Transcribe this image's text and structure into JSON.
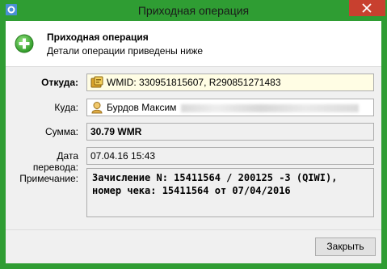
{
  "window": {
    "title": "Приходная операция"
  },
  "header": {
    "title": "Приходная операция",
    "subtitle": "Детали операции приведены ниже"
  },
  "fields": {
    "from": {
      "label": "Откуда:",
      "value": "WMID: 330951815607, R290851271483"
    },
    "to": {
      "label": "Куда:",
      "value": "Бурдов Максим"
    },
    "amount": {
      "label": "Сумма:",
      "value": "30.79 WMR"
    },
    "date": {
      "label": "Дата перевода:",
      "value": "07.04.16 15:43"
    },
    "note": {
      "label": "Примечание:",
      "value": "Зачисление N: 15411564 / 200125 -3 (QIWI), номер чека: 15411564 от  07/04/2016"
    }
  },
  "footer": {
    "close_label": "Закрыть"
  },
  "icons": {
    "title": "webmoney-icon",
    "header": "plus-icon",
    "from": "wallet-icon",
    "to": "user-icon"
  },
  "colors": {
    "titlebar": "#2f9d33",
    "close": "#c8402f",
    "from_field": "#fffde4"
  }
}
